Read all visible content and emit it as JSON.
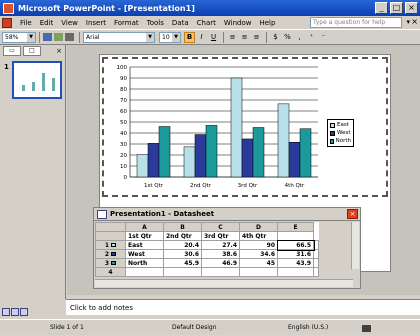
{
  "window": {
    "title": "Microsoft PowerPoint - [Presentation1]"
  },
  "menu": {
    "items": [
      "File",
      "Edit",
      "View",
      "Insert",
      "Format",
      "Tools",
      "Data",
      "Chart",
      "Window",
      "Help"
    ],
    "help_placeholder": "Type a question for help"
  },
  "toolbar": {
    "zoom": "58%",
    "font": "Arial",
    "size": "10",
    "bold": "B",
    "italic": "I",
    "underline": "U"
  },
  "slide_panel": {
    "slide_number": "1"
  },
  "chart_data": {
    "type": "bar",
    "categories": [
      "1st Qtr",
      "2nd Qtr",
      "3rd Qtr",
      "4th Qtr"
    ],
    "series": [
      {
        "name": "East",
        "values": [
          20.4,
          27.4,
          90,
          66.5
        ],
        "color": "#b8e0e8"
      },
      {
        "name": "West",
        "values": [
          30.6,
          38.6,
          34.6,
          31.6
        ],
        "color": "#2a3a9a"
      },
      {
        "name": "North",
        "values": [
          45.9,
          46.9,
          45,
          43.9
        ],
        "color": "#1a9a9a"
      }
    ],
    "ylim": [
      0,
      100
    ],
    "yticks": [
      0,
      10,
      20,
      30,
      40,
      50,
      60,
      70,
      80,
      90,
      100
    ],
    "legend_position": "right"
  },
  "datasheet": {
    "title": "Presentation1 - Datasheet",
    "columns": [
      "A",
      "B",
      "C",
      "D",
      "E"
    ],
    "headers": [
      "1st Qtr",
      "2nd Qtr",
      "3rd Qtr",
      "4th Qtr"
    ],
    "rows": [
      {
        "num": "1",
        "label": "East",
        "values": [
          "20.4",
          "27.4",
          "90",
          "66.5"
        ]
      },
      {
        "num": "2",
        "label": "West",
        "values": [
          "30.6",
          "38.6",
          "34.6",
          "31.6"
        ]
      },
      {
        "num": "3",
        "label": "North",
        "values": [
          "45.9",
          "46.9",
          "45",
          "43.9"
        ]
      },
      {
        "num": "4",
        "label": "",
        "values": [
          "",
          "",
          "",
          ""
        ]
      }
    ]
  },
  "notes": {
    "placeholder": "Click to add notes"
  },
  "status": {
    "slide": "Slide 1 of 1",
    "design": "Default Design",
    "language": "English (U.S.)"
  }
}
